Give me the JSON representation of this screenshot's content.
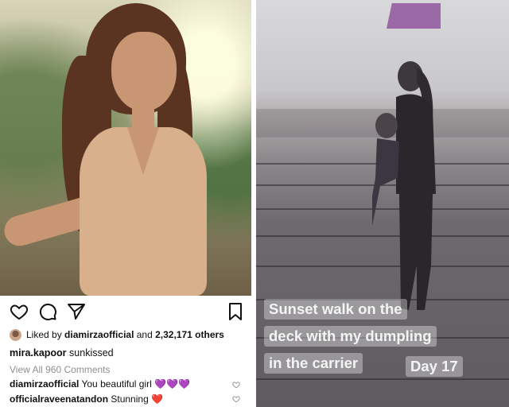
{
  "post": {
    "liked_by_prefix": "Liked by",
    "liked_by_user": "diamirzaofficial",
    "liked_and": "and",
    "liked_count": "2,32,171 others",
    "caption_user": "mira.kapoor",
    "caption_text": "sunkissed",
    "view_comments": "View All 960 Comments",
    "comments": [
      {
        "user": "diamirzaofficial",
        "text": "You beautiful girl",
        "emoji": "💜💜💜"
      },
      {
        "user": "officialraveenatandon",
        "text": "Stunning",
        "emoji": "❤️"
      }
    ],
    "icons": [
      "heart-icon",
      "comment-icon",
      "share-icon",
      "bookmark-icon"
    ]
  },
  "story": {
    "text_lines": [
      "Sunset walk on the",
      "deck with my dumpling",
      "in the carrier"
    ],
    "day_label": "Day 17"
  },
  "colors": {
    "like_heart": "#e0245e",
    "purple_heart": "#c061c8",
    "story_sign": "#9a69a6"
  }
}
